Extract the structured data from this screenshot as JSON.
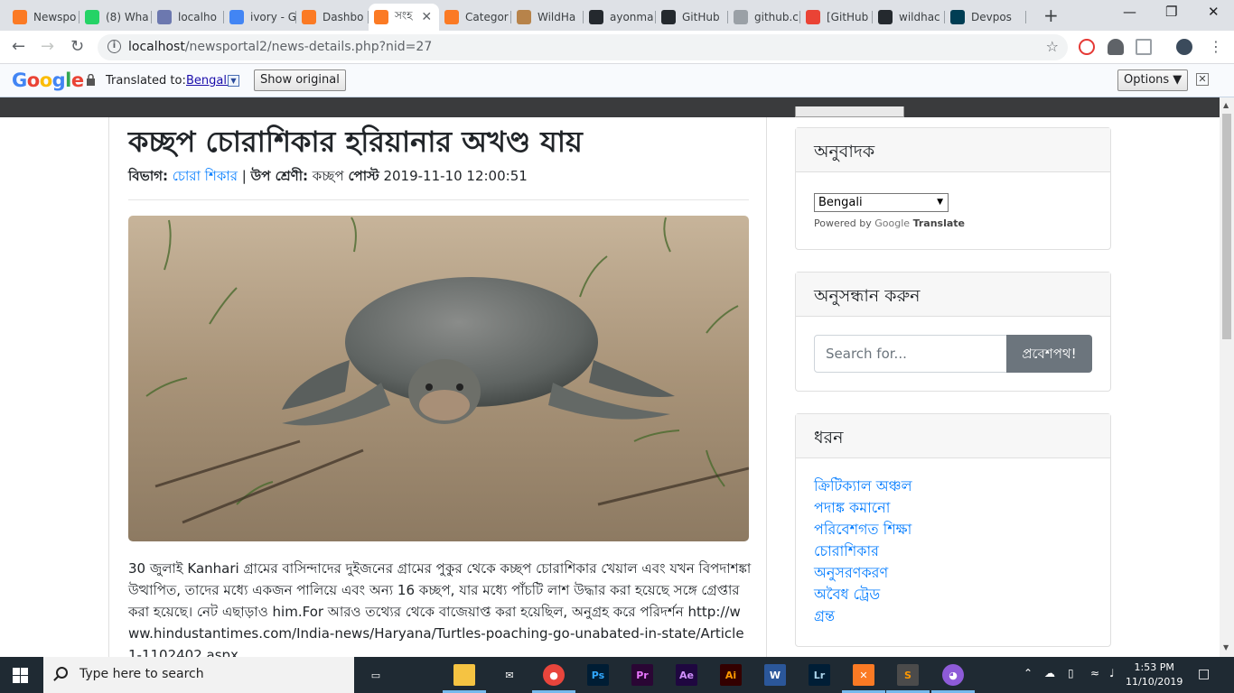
{
  "browser": {
    "tabs": [
      {
        "title": "Newspo",
        "favicon": "xampp",
        "color": "#fb7a24"
      },
      {
        "title": "(8) Wha",
        "favicon": "whatsapp",
        "color": "#25d366"
      },
      {
        "title": "localho",
        "favicon": "phpmyadmin",
        "color": "#6c78af"
      },
      {
        "title": "ivory - G",
        "favicon": "google",
        "color": "#4285f4"
      },
      {
        "title": "Dashbo",
        "favicon": "xampp",
        "color": "#fb7a24"
      },
      {
        "title": "সংহ",
        "favicon": "xampp",
        "color": "#fb7a24",
        "active": true
      },
      {
        "title": "Categor",
        "favicon": "xampp",
        "color": "#fb7a24"
      },
      {
        "title": "WildHa",
        "favicon": "monkey",
        "color": "#b7834a"
      },
      {
        "title": "ayonma",
        "favicon": "github",
        "color": "#24292e"
      },
      {
        "title": "GitHub",
        "favicon": "github",
        "color": "#24292e"
      },
      {
        "title": "github.c",
        "favicon": "globe",
        "color": "#9aa0a6"
      },
      {
        "title": "[GitHub",
        "favicon": "gmail",
        "color": "#ea4335"
      },
      {
        "title": "wildhac",
        "favicon": "github",
        "color": "#24292e"
      },
      {
        "title": "Devpos",
        "favicon": "devpost",
        "color": "#003e54"
      }
    ],
    "url_host": "localhost",
    "url_path": "/newsportal2/news-details.php?nid=27"
  },
  "translate_bar": {
    "logo": "Google",
    "translated_to_label": "Translated to:",
    "language": "Bengali",
    "show_original": "Show original",
    "options": "Options ▼"
  },
  "article": {
    "headline": "কচ্ছপ চোরাশিকার হরিয়ানার অখণ্ড যায়",
    "category_label": "বিভাগ:",
    "category": "চোরা শিকার",
    "subcategory_label": "উপ শ্রেণী:",
    "subcategory": "কচ্ছপ",
    "posted_label": "পোস্ট",
    "posted_date": "2019-11-10 12:00:51",
    "body": " 30 জুলাই Kanhari গ্রামের বাসিন্দাদের দুইজনের গ্রামের পুকুর থেকে কচ্ছপ চোরাশিকার খেয়াল এবং যখন বিপদাশঙ্কা উত্থাপিত, তাদের মধ্যে একজন পালিয়ে এবং অন্য 16 কচ্ছপ, যার মধ্যে পাঁচটি লাশ উদ্ধার করা হয়েছে সঙ্গে গ্রেপ্তার করা হয়েছে। নেট এছাড়াও him.For আরও তথ্যের থেকে বাজেয়াপ্ত করা হয়েছিল, অনুগ্রহ করে পরিদর্শন ",
    "link": "http://www.hindustantimes.com/India-news/Haryana/Turtles-poaching-go-unabated-in-state/Article1-1102402.aspx"
  },
  "sidebar": {
    "translator": {
      "title": "অনুবাদক",
      "selected_language": "Bengali",
      "powered_by": "Powered by",
      "google": "Google",
      "translate": "Translate"
    },
    "search": {
      "title": "অনুসন্ধান করুন",
      "placeholder": "Search for...",
      "button": "প্রবেশপথ!"
    },
    "categories": {
      "title": "ধরন",
      "items": [
        "ক্রিটিক্যাল অঞ্চল",
        "পদাঙ্ক কমানো",
        "পরিবেশগত শিক্ষা",
        "চোরাশিকার",
        "অনুসরণকরণ",
        "অবৈধ ট্রেড",
        "গ্রন্ত"
      ]
    }
  },
  "taskbar": {
    "search_placeholder": "Type here to search",
    "apps": [
      "task-view",
      "file-explorer",
      "mail",
      "chrome",
      "photoshop",
      "premiere",
      "after-effects",
      "illustrator",
      "word",
      "lightroom",
      "xampp",
      "sublime",
      "cat-app"
    ],
    "time": "1:53 PM",
    "date": "11/10/2019"
  }
}
